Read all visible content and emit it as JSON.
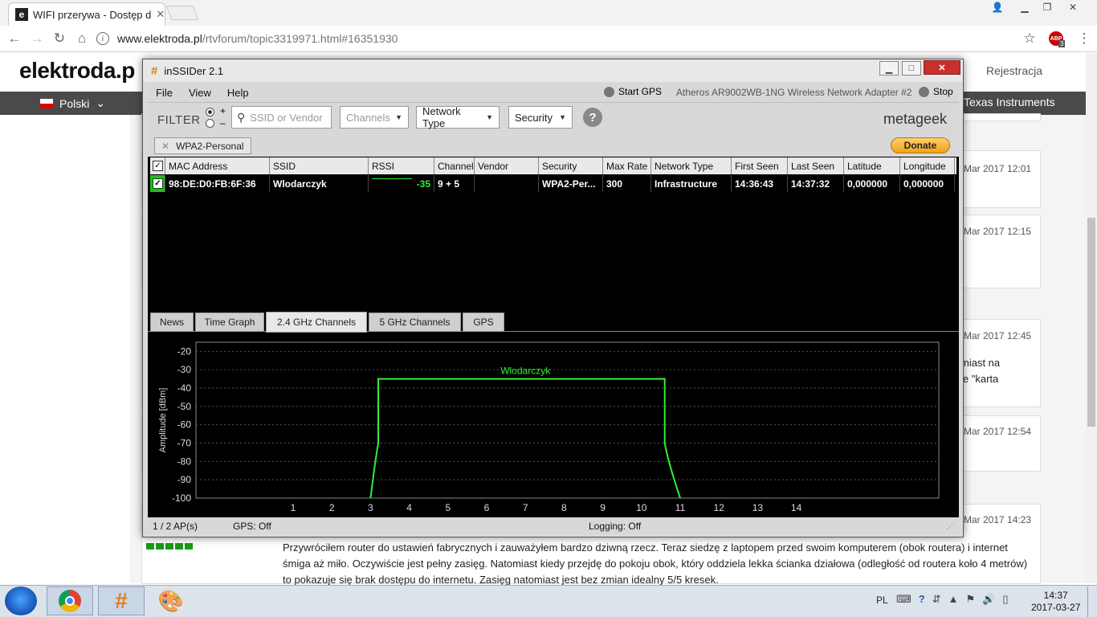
{
  "browser": {
    "tab_title": "WIFI przerywa - Dostęp d",
    "tab_favicon": "e",
    "url_host": "www.elektroda.pl",
    "url_path": "/rtvforum/topic3319971.html#16351930",
    "ext_badge": "3"
  },
  "page": {
    "logo": "elektroda.p",
    "register": "Rejestracja",
    "language": "Polski",
    "nav_right": "Texas Instruments",
    "dates": [
      "Mar 2017 12:01",
      "Mar 2017 12:15",
      "Mar 2017 12:45",
      "Mar 2017 12:54",
      "Mar 2017 14:23"
    ],
    "snippet1": "miast na",
    "snippet2": "ie \"karta",
    "post_text": "Przywróciłem router do ustawień fabrycznych i zauważyłem bardzo dziwną rzecz. Teraz siedzę z laptopem przed swoim komputerem (obok routera) i internet śmiga aż miło. Oczywiście jest pełny zasięg. Natomiast kiedy przejdę do pokoju obok, który oddziela lekka ścianka działowa (odległość od routera koło 4 metrów) to pokazuje się brak dostępu do internetu. Zasięg natomiast jest bez zmian idealny 5/5 kresek."
  },
  "app": {
    "title": "inSSIDer 2.1",
    "menu": [
      "File",
      "View",
      "Help"
    ],
    "start_gps": "Start GPS",
    "adapter": "Atheros AR9002WB-1NG Wireless Network Adapter #2",
    "stop": "Stop",
    "filter_label": "FILTER",
    "radio_plus": "+",
    "radio_minus": "–",
    "ssid_placeholder": "SSID or Vendor",
    "channels": "Channels",
    "network_type": "Network Type",
    "security": "Security",
    "help": "?",
    "brand": "metageek",
    "tag": "WPA2-Personal",
    "donate": "Donate",
    "columns": [
      "MAC Address",
      "SSID",
      "RSSI",
      "Channel",
      "Vendor",
      "Security",
      "Max Rate",
      "Network Type",
      "First Seen",
      "Last Seen",
      "Latitude",
      "Longitude"
    ],
    "rows": [
      {
        "mac": "98:DE:D0:FB:6F:36",
        "ssid": "Wlodarczyk",
        "rssi": "-35",
        "channel": "9 + 5",
        "vendor": "",
        "security": "WPA2-Per...",
        "max_rate": "300",
        "network_type": "Infrastructure",
        "first_seen": "14:36:43",
        "last_seen": "14:37:32",
        "latitude": "0,000000",
        "longitude": "0,000000"
      }
    ],
    "tabs": [
      "News",
      "Time Graph",
      "2.4 GHz Channels",
      "5 GHz Channels",
      "GPS"
    ],
    "active_tab": "2.4 GHz Channels",
    "status_aps": "1 / 2 AP(s)",
    "status_gps": "GPS: Off",
    "status_logging": "Logging: Off"
  },
  "chart_data": {
    "type": "line",
    "title": "",
    "xlabel": "",
    "ylabel": "Amplitude [dBm]",
    "x_ticks": [
      "1",
      "2",
      "3",
      "4",
      "5",
      "6",
      "7",
      "8",
      "9",
      "10",
      "11",
      "12",
      "13",
      "14"
    ],
    "y_ticks": [
      "-20",
      "-30",
      "-40",
      "-50",
      "-60",
      "-70",
      "-80",
      "-90",
      "-100"
    ],
    "ylim": [
      -100,
      -15
    ],
    "series": [
      {
        "name": "Wlodarczyk",
        "center_channel": 7,
        "span_channels": [
          3,
          11
        ],
        "flat_top_channels": [
          3.2,
          10.6
        ],
        "peak_dbm": -35,
        "color": "#33ee33"
      }
    ]
  },
  "taskbar": {
    "lang": "PL",
    "time": "14:37",
    "date": "2017-03-27"
  }
}
